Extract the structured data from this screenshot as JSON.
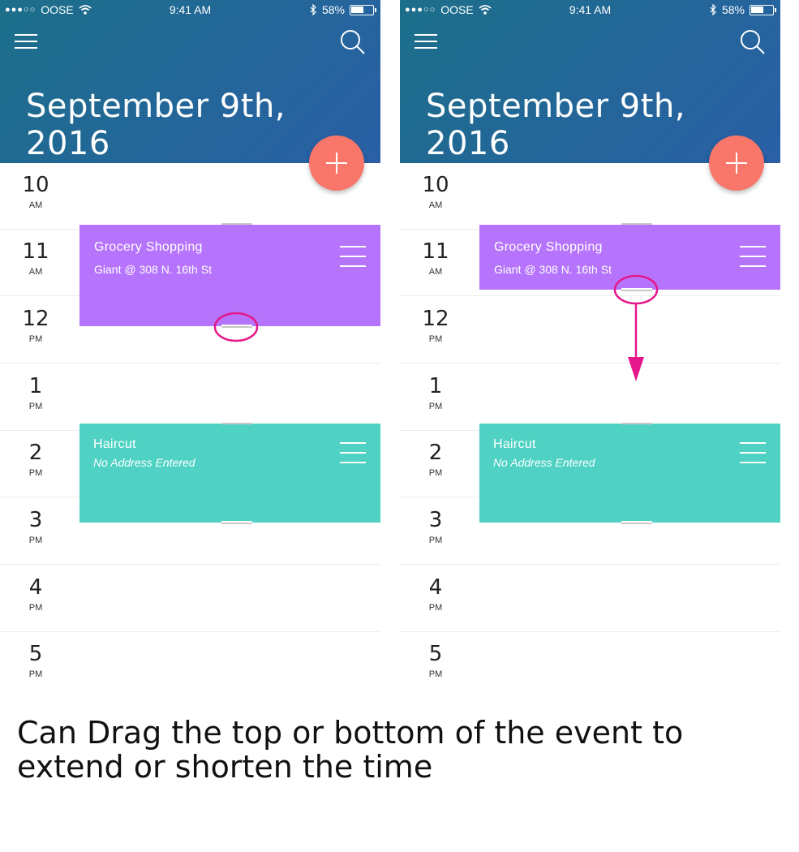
{
  "status_bar": {
    "carrier": "OOSE",
    "time": "9:41 AM",
    "battery": "58%",
    "battery_level": 0.58
  },
  "header": {
    "date_title": "September 9th, 2016"
  },
  "hours": [
    {
      "hour": "10",
      "ampm": "AM"
    },
    {
      "hour": "11",
      "ampm": "AM"
    },
    {
      "hour": "12",
      "ampm": "PM"
    },
    {
      "hour": "1",
      "ampm": "PM"
    },
    {
      "hour": "2",
      "ampm": "PM"
    },
    {
      "hour": "3",
      "ampm": "PM"
    },
    {
      "hour": "4",
      "ampm": "PM"
    },
    {
      "hour": "5",
      "ampm": "PM"
    }
  ],
  "events": {
    "grocery": {
      "title": "Grocery Shopping",
      "location": "Giant @ 308 N. 16th St",
      "color": "#b574fb"
    },
    "haircut": {
      "title": "Haircut",
      "location": "No Address Entered",
      "color": "#4fd2c3"
    }
  },
  "colors": {
    "header_start": "#1c6f8a",
    "header_end": "#2a5fa6",
    "fab": "#f9776a",
    "annotation": "#e5178a"
  },
  "icons": {
    "menu": "hamburger-icon",
    "search": "search-icon",
    "add": "plus-icon",
    "event_menu": "drag-reorder-icon"
  },
  "caption": "Can Drag the top or bottom of the event to extend or shorten the time"
}
